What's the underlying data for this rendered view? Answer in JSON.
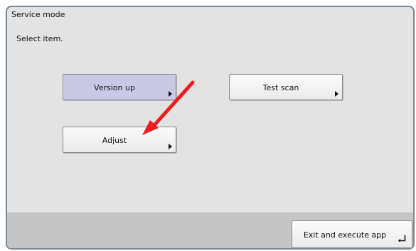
{
  "window": {
    "title": "Service mode"
  },
  "main": {
    "prompt": "Select item.",
    "buttons": [
      {
        "label": "Version up",
        "selected": true
      },
      {
        "label": "Test scan",
        "selected": false
      },
      {
        "label": "Adjust",
        "selected": false
      }
    ]
  },
  "footer": {
    "exit_label": "Exit and execute app"
  },
  "annotation": {
    "arrow_color": "#ee1c1c",
    "arrow_target": "Adjust"
  },
  "icons": {
    "button_chevron": "chevron-right-icon",
    "exit_icon": "enter-return-icon"
  }
}
